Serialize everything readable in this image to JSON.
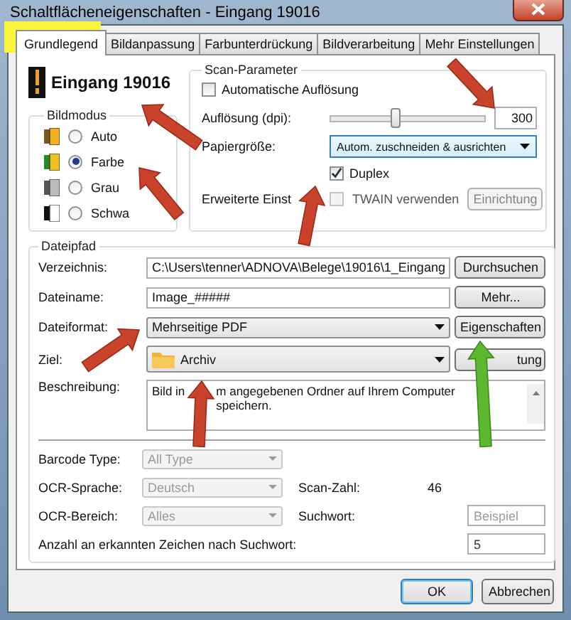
{
  "window": {
    "title": "Schaltflächeneigenschaften - Eingang 19016"
  },
  "tabs": [
    {
      "label": "Grundlegend",
      "selected": true
    },
    {
      "label": "Bildanpassung",
      "selected": false
    },
    {
      "label": "Farbunterdrückung",
      "selected": false
    },
    {
      "label": "Bildverarbeitung",
      "selected": false
    },
    {
      "label": "Mehr Einstellungen",
      "selected": false
    }
  ],
  "header": {
    "name": "Eingang 19016"
  },
  "bildmodus": {
    "title": "Bildmodus",
    "options": [
      {
        "label": "Auto",
        "selected": false,
        "kind": "auto"
      },
      {
        "label": "Farbe",
        "selected": true,
        "kind": "color"
      },
      {
        "label": "Grau",
        "selected": false,
        "kind": "gray"
      },
      {
        "label": "Schwa",
        "selected": false,
        "kind": "bw"
      }
    ]
  },
  "scan": {
    "title": "Scan-Parameter",
    "auto_resolution": {
      "label": "Automatische Auflösung",
      "checked": false
    },
    "resolution": {
      "label": "Auflösung (dpi):",
      "level": 0.42,
      "value": "300"
    },
    "paper": {
      "label": "Papiergröße:",
      "value": "Autom. zuschneiden & ausrichten"
    },
    "duplex": {
      "label": "Duplex",
      "checked": true
    },
    "advanced": {
      "label": "Erweiterte Einst",
      "twain": {
        "label": "TWAIN verwenden",
        "checked": false,
        "disabled": true
      },
      "button": {
        "label": "Einrichtung",
        "disabled": true
      }
    }
  },
  "dateipfad": {
    "title": "Dateipfad",
    "rows": [
      {
        "kind": "text",
        "label": "Verzeichnis:",
        "value": "C:\\Users\\tenner\\ADNOVA\\Belege\\19016\\1_Eingang",
        "button": "Durchsuchen"
      },
      {
        "kind": "text",
        "label": "Dateiname:",
        "value": "Image_#####",
        "button": "Mehr..."
      },
      {
        "kind": "select",
        "label": "Dateiformat:",
        "value": "Mehrseitige PDF",
        "button": "Eigenschaften"
      },
      {
        "kind": "folder",
        "label": "Ziel:",
        "value": "Archiv",
        "button": "tung"
      }
    ],
    "description": {
      "label": "Beschreibung:",
      "parts": [
        "Bild in",
        "m angegebenen Ordner auf Ihrem Computer speichern."
      ]
    },
    "ocr_rows": [
      {
        "kind": "select",
        "label": "Barcode Type:",
        "value": "All Type",
        "disabled": true
      },
      {
        "kind": "select_readout",
        "label": "OCR-Sprache:",
        "value": "Deutsch",
        "disabled": true,
        "extra_label": "Scan-Zahl:",
        "extra_value": "46"
      },
      {
        "kind": "select_field",
        "label": "OCR-Bereich:",
        "value": "Alles",
        "disabled": true,
        "extra_label": "Suchwort:",
        "placeholder": "Beispiel"
      },
      {
        "kind": "field",
        "label": "Anzahl an erkannten Zeichen nach Suchwort:",
        "value": "5"
      }
    ]
  },
  "buttons": [
    {
      "label": "OK",
      "default": true
    },
    {
      "label": "Abbrechen",
      "default": false
    }
  ]
}
